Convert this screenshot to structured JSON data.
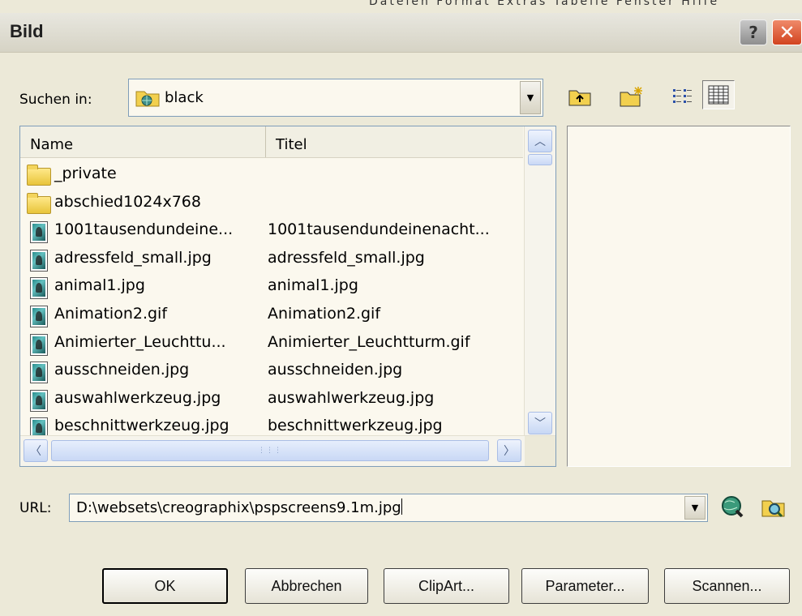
{
  "window": {
    "title": "Bild",
    "help_label": "?",
    "close_label": "✕",
    "background_menu_fragment": "Dateien Format Extras Tabelle Fenster Hilfe"
  },
  "lookin": {
    "label": "Suchen in:",
    "value": "black",
    "toolbar_icons": [
      "up-folder-icon",
      "new-folder-icon",
      "list-view-icon",
      "details-view-icon"
    ]
  },
  "filelist": {
    "columns": [
      "Name",
      "Titel"
    ],
    "rows": [
      {
        "name": "_private",
        "title": "",
        "type": "folder"
      },
      {
        "name": "abschied1024x768",
        "title": "",
        "type": "folder"
      },
      {
        "name": "1001tausendundeine...",
        "title": "1001tausendundeinenacht...",
        "type": "image"
      },
      {
        "name": "adressfeld_small.jpg",
        "title": "adressfeld_small.jpg",
        "type": "image"
      },
      {
        "name": "animal1.jpg",
        "title": "animal1.jpg",
        "type": "image"
      },
      {
        "name": "Animation2.gif",
        "title": "Animation2.gif",
        "type": "image"
      },
      {
        "name": "Animierter_Leuchttu...",
        "title": "Animierter_Leuchtturm.gif",
        "type": "image"
      },
      {
        "name": "ausschneiden.jpg",
        "title": "ausschneiden.jpg",
        "type": "image"
      },
      {
        "name": "auswahlwerkzeug.jpg",
        "title": "auswahlwerkzeug.jpg",
        "type": "image"
      },
      {
        "name": "beschnittwerkzeug.jpg",
        "title": "beschnittwerkzeug.jpg",
        "type": "image"
      }
    ]
  },
  "url": {
    "label": "URL:",
    "value": "D:\\websets\\creographix\\pspscreens9.1m.jpg"
  },
  "buttons": {
    "ok": "OK",
    "cancel": "Abbrechen",
    "clipart": "ClipArt...",
    "params": "Parameter...",
    "scan": "Scannen..."
  },
  "colors": {
    "dialog_bg": "#ece9d8",
    "list_bg": "#fbf8ee",
    "close_red": "#d2431f",
    "scroll_blue": "#c9d8f5"
  }
}
